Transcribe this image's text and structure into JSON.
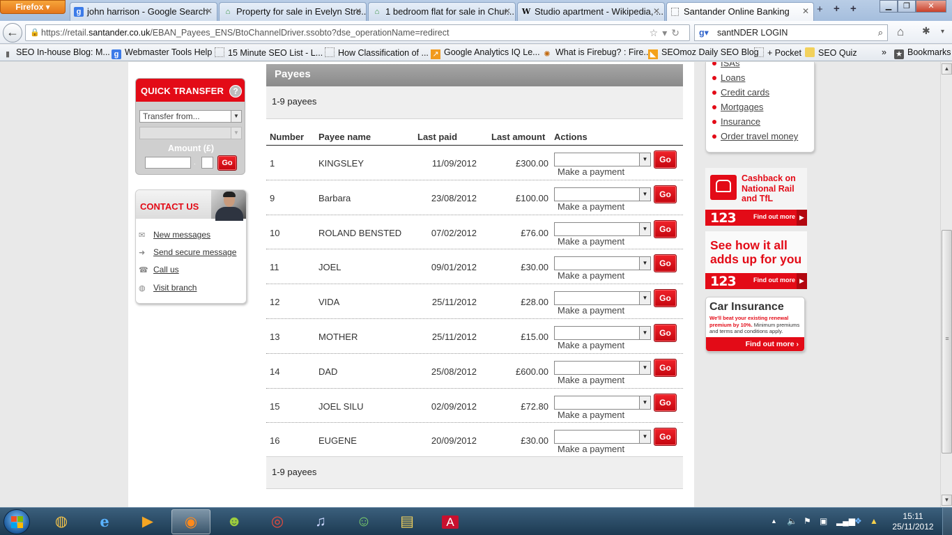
{
  "browser": {
    "firefox_button": "Firefox",
    "tabs": [
      {
        "title": "john harrison - Google Search",
        "icon": "google-icon"
      },
      {
        "title": "Property for sale in Evelyn Stre...",
        "icon": "house-icon"
      },
      {
        "title": "1 bedroom flat for sale in Chur...",
        "icon": "house-icon"
      },
      {
        "title": "Studio apartment - Wikipedia, ...",
        "icon": "wikipedia-icon"
      },
      {
        "title": "Santander Online Banking",
        "icon": "page-icon"
      }
    ],
    "url_prefix": "https://retail.",
    "url_host": "santander.co.uk",
    "url_path": "/EBAN_Payees_ENS/BtoChannelDriver.ssobto?dse_operationName=redirect",
    "search_value": "santNDER LOGIN",
    "bookmarks": [
      "SEO In-house Blog: M...",
      "Webmaster Tools Help",
      "15 Minute SEO List - L...",
      "How Classification of ...",
      "Google Analytics IQ Le...",
      "What is Firebug? : Fire...",
      "SEOmoz Daily SEO Blog",
      "+ Pocket",
      "SEO Quiz"
    ],
    "bookmarks_overflow": "»",
    "bookmarks_menu": "Bookmarks"
  },
  "quick_transfer": {
    "title": "QUICK TRANSFER",
    "help": "?",
    "transfer_from": "Transfer from...",
    "amount_label": "Amount (£)",
    "separator": ".",
    "go": "Go"
  },
  "contact": {
    "title": "CONTACT US",
    "items": [
      "New messages",
      "Send secure message",
      "Call us",
      "Visit branch"
    ]
  },
  "payees": {
    "header": "Payees",
    "count_label": "1-9 payees",
    "columns": [
      "Number",
      "Payee name",
      "Last paid",
      "Last amount",
      "Actions"
    ],
    "action_option": "Make a payment",
    "go": "Go",
    "rows": [
      {
        "number": "1",
        "name": "KINGSLEY",
        "last_paid": "11/09/2012",
        "amount": "£300.00"
      },
      {
        "number": "9",
        "name": "Barbara",
        "last_paid": "23/08/2012",
        "amount": "£100.00"
      },
      {
        "number": "10",
        "name": "ROLAND BENSTED",
        "last_paid": "07/02/2012",
        "amount": "£76.00"
      },
      {
        "number": "11",
        "name": "JOEL",
        "last_paid": "09/01/2012",
        "amount": "£30.00"
      },
      {
        "number": "12",
        "name": "VIDA",
        "last_paid": "25/11/2012",
        "amount": "£28.00"
      },
      {
        "number": "13",
        "name": "MOTHER",
        "last_paid": "25/11/2012",
        "amount": "£15.00"
      },
      {
        "number": "14",
        "name": "DAD",
        "last_paid": "25/08/2012",
        "amount": "£600.00"
      },
      {
        "number": "15",
        "name": "JOEL SILU",
        "last_paid": "02/09/2012",
        "amount": "£72.80"
      },
      {
        "number": "16",
        "name": "EUGENE",
        "last_paid": "20/09/2012",
        "amount": "£30.00"
      }
    ]
  },
  "side_menu": {
    "items": [
      "ISAs",
      "Loans",
      "Credit cards",
      "Mortgages",
      "Insurance",
      "Order travel money"
    ]
  },
  "promos": {
    "cashback": {
      "text": "Cashback on National Rail and TfL",
      "brand": "123",
      "cta": "Find out more"
    },
    "adds_up": {
      "text": "See how it all adds up for you",
      "brand": "123",
      "cta": "Find out more"
    },
    "car_insurance": {
      "title": "Car Insurance",
      "highlight": "We'll beat your existing renewal premium by 10%.",
      "fine": "Minimum premiums and terms and conditions apply.",
      "cta": "Find out more"
    }
  },
  "taskbar": {
    "time": "15:11",
    "date": "25/11/2012"
  },
  "colors": {
    "santander_red": "#e30b17",
    "header_grey": "#8a8a8a"
  }
}
